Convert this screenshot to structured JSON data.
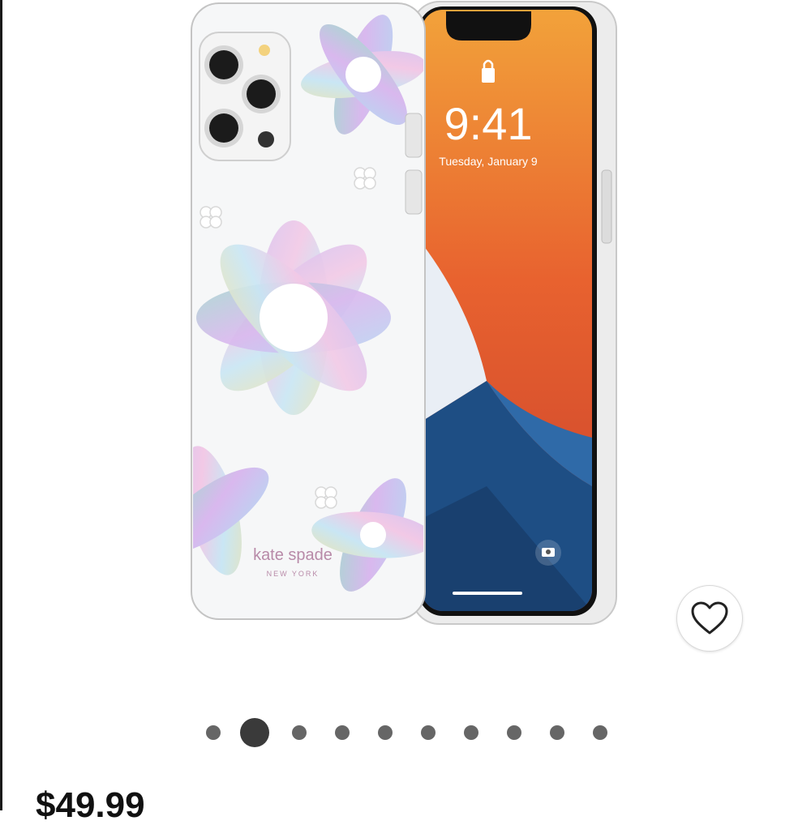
{
  "product": {
    "brand_name": "kate spade",
    "brand_city": "NEW YORK",
    "price": "$49.99"
  },
  "phone_screen": {
    "time": "9:41",
    "date": "Tuesday, January 9"
  },
  "gallery": {
    "image_count": 10,
    "active_index": 1
  },
  "icons": {
    "favorite": "heart-outline-icon",
    "lock": "lock-icon",
    "camera": "camera-icon"
  },
  "colors": {
    "wallpaper_orange": "#e8622f",
    "wallpaper_blue": "#1e4e84",
    "price_text": "#111111",
    "dot_active": "#3a3a3a",
    "dot_inactive": "#666666"
  }
}
